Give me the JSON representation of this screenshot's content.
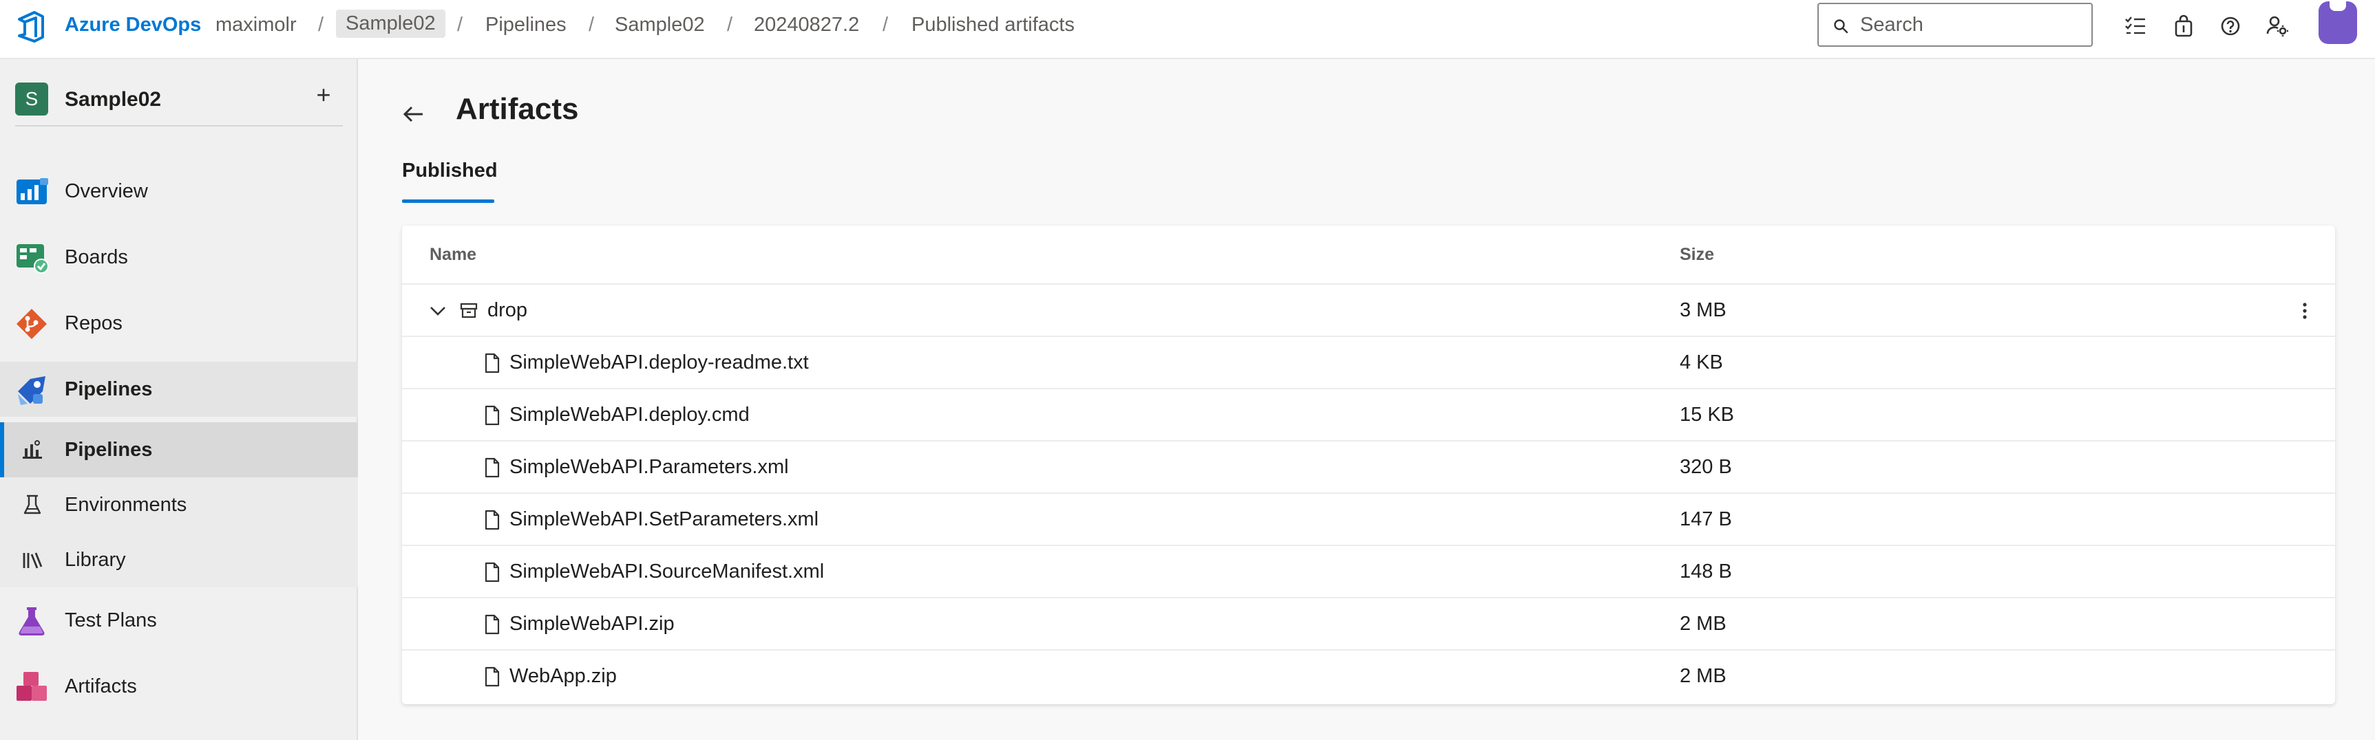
{
  "topbar": {
    "brand": "Azure DevOps",
    "breadcrumbs": [
      {
        "label": "maximolr"
      },
      {
        "label": "Sample02"
      },
      {
        "label": "Pipelines"
      },
      {
        "label": "Sample02"
      },
      {
        "label": "20240827.2"
      },
      {
        "label": "Published artifacts"
      }
    ],
    "separator": "/",
    "search_placeholder": "Search",
    "icons": [
      "checklist-icon",
      "shopping-bag-icon",
      "help-icon",
      "user-settings-icon"
    ]
  },
  "sidebar": {
    "project_initial": "S",
    "project_name": "Sample02",
    "add_symbol": "+",
    "items": [
      {
        "label": "Overview"
      },
      {
        "label": "Boards"
      },
      {
        "label": "Repos"
      },
      {
        "label": "Pipelines"
      },
      {
        "label": "Pipelines"
      },
      {
        "label": "Environments"
      },
      {
        "label": "Library"
      },
      {
        "label": "Test Plans"
      },
      {
        "label": "Artifacts"
      }
    ]
  },
  "main": {
    "title": "Artifacts",
    "tab": "Published",
    "table": {
      "columns": [
        "Name",
        "Size"
      ],
      "folder": {
        "name": "drop",
        "size": "3 MB"
      },
      "files": [
        {
          "name": "SimpleWebAPI.deploy-readme.txt",
          "size": "4 KB"
        },
        {
          "name": "SimpleWebAPI.deploy.cmd",
          "size": "15 KB"
        },
        {
          "name": "SimpleWebAPI.Parameters.xml",
          "size": "320 B"
        },
        {
          "name": "SimpleWebAPI.SetParameters.xml",
          "size": "147 B"
        },
        {
          "name": "SimpleWebAPI.SourceManifest.xml",
          "size": "148 B"
        },
        {
          "name": "SimpleWebAPI.zip",
          "size": "2 MB"
        },
        {
          "name": "WebApp.zip",
          "size": "2 MB"
        }
      ]
    }
  },
  "colors": {
    "accent": "#0078d4",
    "project_badge": "#2d7a59",
    "avatar": "#7758c9"
  }
}
